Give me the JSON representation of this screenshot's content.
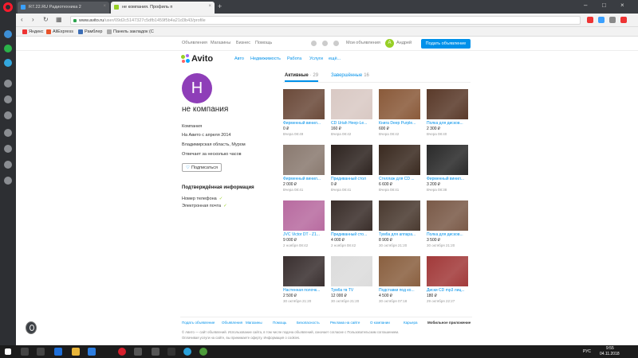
{
  "browser": {
    "tabs": [
      {
        "title": "R7.22.RU Радиотехника 2"
      },
      {
        "title": "не компания. Профиль п"
      }
    ],
    "url_host": "www.avito.ru",
    "url_path": "/user/09d2c5147327c5dfb1459f5b4a21d3b43/profile",
    "bookmarks": [
      "Яндекс",
      "AliExpress",
      "Рамблер",
      "Панель закладок (С"
    ]
  },
  "avito": {
    "topline_links": [
      "Объявления",
      "Магазины",
      "Бизнес",
      "Помощь"
    ],
    "my_ads": "Мои объявления",
    "user_initial": "А",
    "user_name": "Андрей",
    "post_button": "Подать объявление",
    "logo": "Avito",
    "categories": [
      "Авто",
      "Недвижимость",
      "Работа",
      "Услуги",
      "ещё..."
    ]
  },
  "profile": {
    "initial": "Н",
    "name": "не компания",
    "type": "Компания",
    "since": "На Авито с апреля 2014",
    "location": "Владимирская область, Муром",
    "response": "Отвечает за несколько часов",
    "subscribe": "Подписаться",
    "verified_title": "Подтверждённая информация",
    "verified_items": [
      "Номер телефона",
      "Электронная почта"
    ]
  },
  "listing_tabs": {
    "active_label": "Активные",
    "active_count": "· 29",
    "finished_label": "Завершённые",
    "finished_count": "16"
  },
  "listings": [
    {
      "title": "Фирменный винил...",
      "price": "0 ₽",
      "date": "Вчера 08:49",
      "color": "#6b4a3a"
    },
    {
      "title": "CD Uriah Heep-Le...",
      "price": "160 ₽",
      "date": "Вчера 08:42",
      "color": "#d9c9c4"
    },
    {
      "title": "Книга Deep Purple...",
      "price": "600 ₽",
      "date": "Вчера 08:42",
      "color": "#8a5a3a"
    },
    {
      "title": "Полка для дисков...",
      "price": "2 300 ₽",
      "date": "Вчера 08:40",
      "color": "#5a3a2a"
    },
    {
      "title": "Фирменный винил...",
      "price": "2 000 ₽",
      "date": "Вчера 08:41",
      "color": "#8a7a70"
    },
    {
      "title": "Придиванный стол",
      "price": "0 ₽",
      "date": "Вчера 08:41",
      "color": "#2e2420"
    },
    {
      "title": "Стеллаж для CD ...",
      "price": "6 600 ₽",
      "date": "Вчера 08:41",
      "color": "#3a2a20"
    },
    {
      "title": "Фирменный винил...",
      "price": "3 200 ₽",
      "date": "Вчера 08:38",
      "color": "#2a2a2a"
    },
    {
      "title": "JVC Victor DT - Z1...",
      "price": "9 000 ₽",
      "date": "2 ноября 08:42",
      "color": "#b86ba0"
    },
    {
      "title": "Придиванный сто...",
      "price": "4 000 ₽",
      "date": "2 ноября 08:42",
      "color": "#3a2e2a"
    },
    {
      "title": "Тумба для аппара...",
      "price": "8 900 ₽",
      "date": "30 октября 21:20",
      "color": "#4a3a30"
    },
    {
      "title": "Полка для дисков...",
      "price": "3 500 ₽",
      "date": "30 октября 21:20",
      "color": "#7a5a48"
    },
    {
      "title": "Настенная полочк...",
      "price": "2 500 ₽",
      "date": "30 октября 21:20",
      "color": "#3a3030"
    },
    {
      "title": "Тумба тв TV",
      "price": "12 000 ₽",
      "date": "30 октября 21:20",
      "color": "#dcdcdc"
    },
    {
      "title": "Подставки под ко...",
      "price": "4 500 ₽",
      "date": "30 октября 07:18",
      "color": "#8a6040"
    },
    {
      "title": "Диски CD mp3 лиц...",
      "price": "180 ₽",
      "date": "29 октября 22:27",
      "color": "#a23a3a"
    }
  ],
  "footer": {
    "links": [
      "Подать объявление",
      "Объявления",
      "Магазины",
      "Помощь",
      "Безопасность",
      "Реклама на сайте",
      "О компании",
      "Карьера",
      "Мобильное приложение"
    ],
    "note1": "© Авито — сайт объявлений. Использование сайта, в том числе подача объявлений, означает согласие с Пользовательским соглашением.",
    "note2": "Оплачивая услуги на сайте, вы принимаете оферту. Информация о cookies."
  },
  "taskbar": {
    "lang": "РУС",
    "time": "9:55",
    "date": "04.11.2018"
  }
}
